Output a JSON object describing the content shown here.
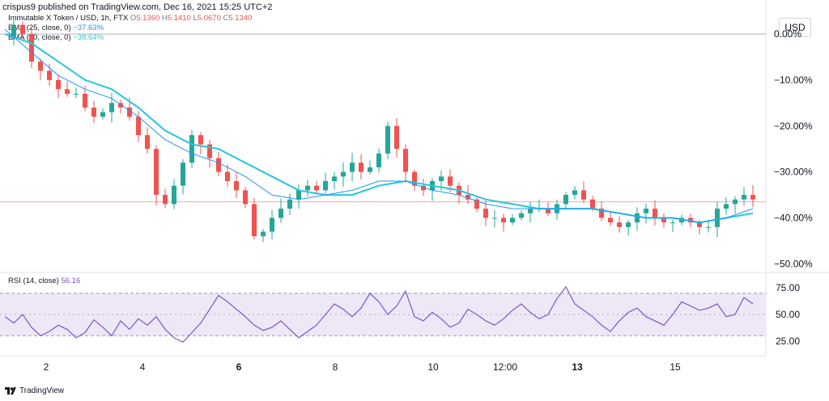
{
  "header": {
    "publisher": "crispus9 published on TradingView.com, Dec 16, 2021 15:25 UTC+2"
  },
  "legend": {
    "symbol": "Immutable X Token / USD, 1h, FTX",
    "ohlc": {
      "o_label": "O",
      "o": "5.1360",
      "h_label": "H",
      "h": "5.1410",
      "l_label": "L",
      "l": "5.0670",
      "c_label": "C",
      "c": "5.1340"
    },
    "ema25_label": "EMA (25, close, 0)",
    "ema25_value": "−37.63%",
    "ema50_label": "EMA (50, close, 0)",
    "ema50_value": "−38.64%",
    "rsi_label": "RSI (14, close)",
    "rsi_value": "56.16"
  },
  "currency_button": "USD",
  "footer": {
    "brand": "TradingView"
  },
  "colors": {
    "up": "#26a69a",
    "down": "#ef5350",
    "ema25": "#2196f3",
    "ema50": "#26c6da",
    "rsi": "#7e57c2",
    "rsi_band": "#ede7f6"
  },
  "chart_data": [
    {
      "type": "candlestick",
      "yaxis_scale": "percent",
      "ylim": [
        -51,
        6
      ],
      "yticks": [
        "0.00%",
        "−10.00%",
        "−20.00%",
        "−30.00%",
        "−40.00%",
        "−50.00%"
      ],
      "ytick_values": [
        0,
        -10,
        -20,
        -30,
        -40,
        -50
      ],
      "xticks": [
        "2",
        "4",
        "6",
        "8",
        "10",
        "12:00",
        "13",
        "15"
      ],
      "xtick_bold": [
        "6",
        "13"
      ],
      "price_line": -36.5,
      "close_path": [
        [
          0,
          -1
        ],
        [
          1,
          2
        ],
        [
          2,
          0
        ],
        [
          3,
          -6
        ],
        [
          4,
          -8
        ],
        [
          5,
          -10
        ],
        [
          6,
          -12
        ],
        [
          7,
          -13
        ],
        [
          8,
          -13
        ],
        [
          9,
          -16
        ],
        [
          10,
          -18
        ],
        [
          11,
          -17
        ],
        [
          12,
          -15
        ],
        [
          13,
          -16
        ],
        [
          14,
          -18
        ],
        [
          15,
          -22
        ],
        [
          16,
          -25
        ],
        [
          17,
          -35
        ],
        [
          18,
          -37
        ],
        [
          19,
          -33
        ],
        [
          20,
          -28
        ],
        [
          21,
          -22
        ],
        [
          22,
          -24
        ],
        [
          23,
          -27
        ],
        [
          24,
          -30
        ],
        [
          25,
          -32
        ],
        [
          26,
          -34
        ],
        [
          27,
          -37
        ],
        [
          28,
          -44
        ],
        [
          29,
          -43
        ],
        [
          30,
          -40
        ],
        [
          31,
          -38
        ],
        [
          32,
          -36
        ],
        [
          33,
          -34
        ],
        [
          34,
          -33
        ],
        [
          35,
          -34
        ],
        [
          36,
          -32
        ],
        [
          37,
          -31
        ],
        [
          38,
          -30
        ],
        [
          39,
          -28
        ],
        [
          40,
          -30
        ],
        [
          41,
          -29
        ],
        [
          42,
          -26
        ],
        [
          43,
          -20
        ],
        [
          44,
          -25
        ],
        [
          45,
          -30
        ],
        [
          46,
          -33
        ],
        [
          47,
          -34
        ],
        [
          48,
          -32
        ],
        [
          49,
          -31
        ],
        [
          50,
          -33
        ],
        [
          51,
          -35
        ],
        [
          52,
          -36
        ],
        [
          53,
          -38
        ],
        [
          54,
          -40
        ],
        [
          55,
          -40
        ],
        [
          56,
          -41
        ],
        [
          57,
          -40
        ],
        [
          58,
          -39
        ],
        [
          59,
          -38
        ],
        [
          60,
          -38
        ],
        [
          61,
          -39
        ],
        [
          62,
          -37
        ],
        [
          63,
          -35
        ],
        [
          64,
          -34
        ],
        [
          65,
          -36
        ],
        [
          66,
          -38
        ],
        [
          67,
          -40
        ],
        [
          68,
          -41
        ],
        [
          69,
          -42
        ],
        [
          70,
          -41
        ],
        [
          71,
          -39
        ],
        [
          72,
          -38
        ],
        [
          73,
          -40
        ],
        [
          74,
          -41
        ],
        [
          75,
          -41
        ],
        [
          76,
          -40
        ],
        [
          77,
          -41
        ],
        [
          78,
          -42
        ],
        [
          79,
          -42
        ],
        [
          80,
          -38
        ],
        [
          81,
          -37
        ],
        [
          82,
          -36
        ],
        [
          83,
          -35
        ],
        [
          84,
          -36
        ]
      ],
      "ema25": [
        [
          0,
          1
        ],
        [
          3,
          -4
        ],
        [
          6,
          -9
        ],
        [
          9,
          -12
        ],
        [
          12,
          -14
        ],
        [
          15,
          -18
        ],
        [
          18,
          -23
        ],
        [
          21,
          -26
        ],
        [
          24,
          -28
        ],
        [
          27,
          -31
        ],
        [
          30,
          -35
        ],
        [
          33,
          -36
        ],
        [
          36,
          -35
        ],
        [
          39,
          -34
        ],
        [
          42,
          -32
        ],
        [
          45,
          -32
        ],
        [
          48,
          -34
        ],
        [
          51,
          -35
        ],
        [
          54,
          -37
        ],
        [
          57,
          -38
        ],
        [
          60,
          -38
        ],
        [
          63,
          -38
        ],
        [
          66,
          -38
        ],
        [
          69,
          -39
        ],
        [
          72,
          -40
        ],
        [
          75,
          -40
        ],
        [
          78,
          -41
        ],
        [
          81,
          -40
        ],
        [
          84,
          -38
        ]
      ],
      "ema50": [
        [
          0,
          0
        ],
        [
          3,
          -2
        ],
        [
          6,
          -6
        ],
        [
          9,
          -10
        ],
        [
          12,
          -12
        ],
        [
          15,
          -16
        ],
        [
          18,
          -21
        ],
        [
          21,
          -24
        ],
        [
          24,
          -25
        ],
        [
          27,
          -28
        ],
        [
          30,
          -31
        ],
        [
          33,
          -34
        ],
        [
          36,
          -35
        ],
        [
          39,
          -35
        ],
        [
          42,
          -33
        ],
        [
          45,
          -32
        ],
        [
          48,
          -33
        ],
        [
          51,
          -34
        ],
        [
          54,
          -36
        ],
        [
          57,
          -37
        ],
        [
          60,
          -38
        ],
        [
          63,
          -38
        ],
        [
          66,
          -38
        ],
        [
          69,
          -39
        ],
        [
          72,
          -40
        ],
        [
          75,
          -40
        ],
        [
          78,
          -41
        ],
        [
          81,
          -40
        ],
        [
          84,
          -39
        ]
      ]
    },
    {
      "type": "line",
      "name": "RSI (14, close)",
      "ylim": [
        15,
        82
      ],
      "yticks": [
        "75.00",
        "50.00",
        "25.00"
      ],
      "ytick_values": [
        75,
        50,
        25
      ],
      "band": [
        30,
        70
      ],
      "midline": 50,
      "values": [
        48,
        42,
        50,
        38,
        30,
        34,
        40,
        36,
        28,
        33,
        45,
        38,
        30,
        44,
        36,
        46,
        40,
        48,
        36,
        28,
        24,
        33,
        42,
        55,
        68,
        62,
        55,
        48,
        40,
        35,
        38,
        44,
        36,
        28,
        34,
        40,
        50,
        60,
        55,
        48,
        56,
        70,
        62,
        50,
        58,
        72,
        48,
        44,
        52,
        46,
        38,
        42,
        55,
        50,
        44,
        40,
        46,
        54,
        60,
        52,
        46,
        50,
        65,
        76,
        60,
        54,
        48,
        40,
        34,
        44,
        52,
        56,
        48,
        44,
        40,
        50,
        62,
        58,
        54,
        56,
        60,
        48,
        50,
        66,
        60
      ]
    }
  ]
}
